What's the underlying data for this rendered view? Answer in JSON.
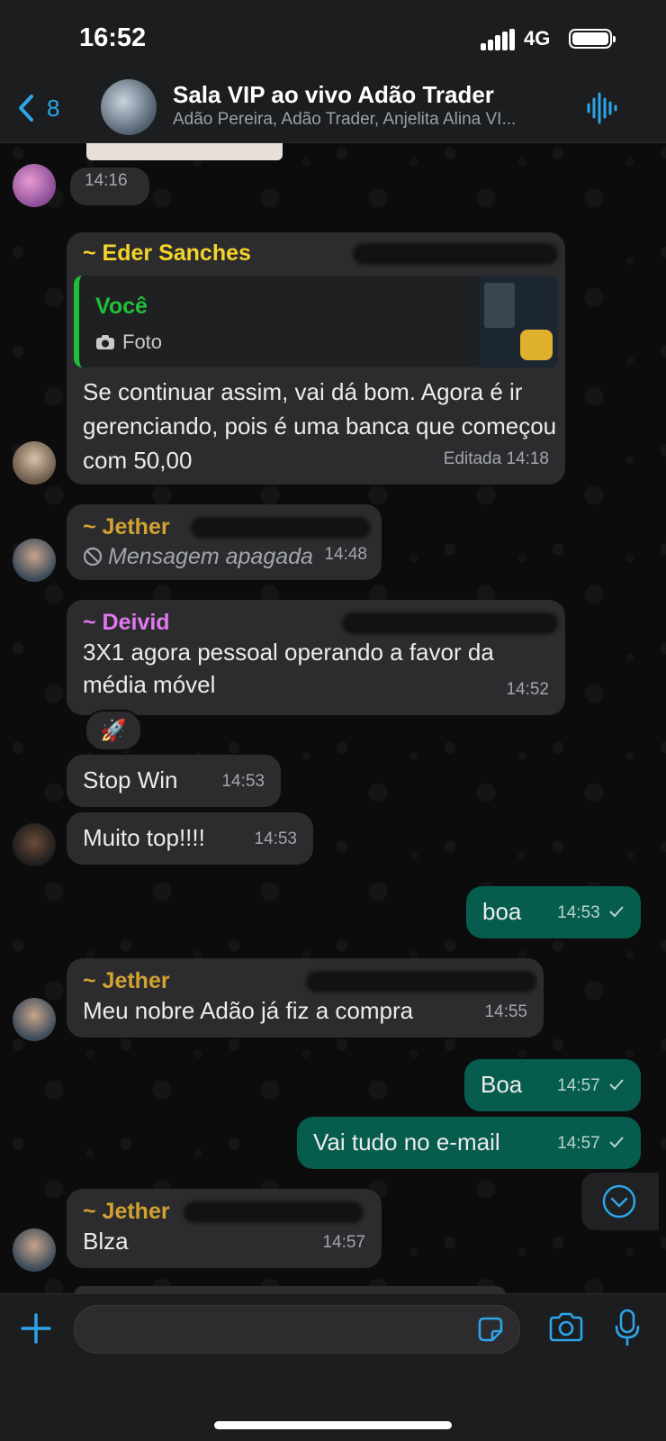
{
  "status_bar": {
    "time": "16:52",
    "network": "4G"
  },
  "header": {
    "back_count": "8",
    "title": "Sala VIP ao vivo Adão Trader",
    "subtitle": "Adão Pereira, Adão Trader, Anjelita Alina VI..."
  },
  "messages": {
    "m1": {
      "time": "14:16"
    },
    "m2": {
      "sender": "~ Eder Sanches",
      "quote_name": "Você",
      "quote_type": "Foto",
      "text": "Se continuar assim, vai dá bom. Agora é ir gerenciando, pois é uma banca que começou com 50,00",
      "time": "Editada 14:18"
    },
    "m3": {
      "sender": "~ Jether",
      "text": "Mensagem apagada",
      "time": "14:48"
    },
    "m4": {
      "sender": "~ Deivid",
      "text": "3X1 agora pessoal operando a favor da média móvel",
      "time": "14:52",
      "reaction": "🚀"
    },
    "m5": {
      "text": "Stop Win",
      "time": "14:53"
    },
    "m6": {
      "text": "Muito top!!!!",
      "time": "14:53"
    },
    "m7": {
      "text": "boa",
      "time": "14:53"
    },
    "m8": {
      "sender": "~ Jether",
      "text": "Meu nobre Adão já fiz a compra",
      "time": "14:55"
    },
    "m9": {
      "text": "Boa",
      "time": "14:57"
    },
    "m10": {
      "text": "Vai tudo no e-mail",
      "time": "14:57"
    },
    "m11": {
      "sender": "~ Jether",
      "text": "Blza",
      "time": "14:57"
    }
  },
  "colors": {
    "accent": "#2ea4ea",
    "outgoing_bubble": "#065d4e",
    "incoming_bubble": "#2c2c2e",
    "eder_name": "#f4d42a",
    "jether_name": "#d1a231",
    "deivid_name": "#e277f0",
    "quote_name": "#1fbf3a"
  },
  "icons": [
    "back-chevron-icon",
    "audio-wave-icon",
    "camera-icon",
    "deleted-icon",
    "check-icon",
    "chevron-down-circle-icon",
    "plus-icon",
    "sticker-icon",
    "microphone-icon"
  ]
}
